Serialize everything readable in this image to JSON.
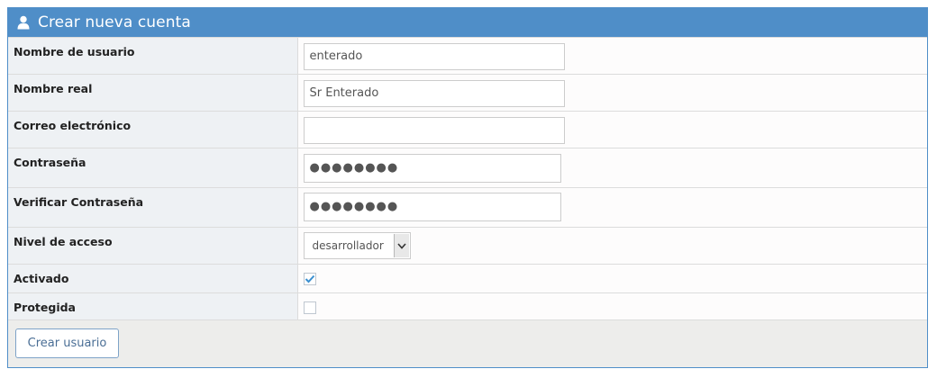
{
  "header": {
    "title": "Crear nueva cuenta",
    "icon": "user-icon",
    "color": "#4f8ec8"
  },
  "fields": {
    "username": {
      "label": "Nombre de usuario",
      "value": "enterado"
    },
    "realname": {
      "label": "Nombre real",
      "value": "Sr Enterado"
    },
    "email": {
      "label": "Correo electrónico",
      "value": ""
    },
    "password": {
      "label": "Contraseña",
      "value": "●●●●●●●●"
    },
    "password_verify": {
      "label": "Verificar Contraseña",
      "value": "●●●●●●●●"
    },
    "access_level": {
      "label": "Nivel de acceso",
      "value": "desarrollador"
    },
    "enabled": {
      "label": "Activado",
      "checked": true
    },
    "protected": {
      "label": "Protegida",
      "checked": false
    }
  },
  "footer": {
    "submit_label": "Crear usuario"
  }
}
